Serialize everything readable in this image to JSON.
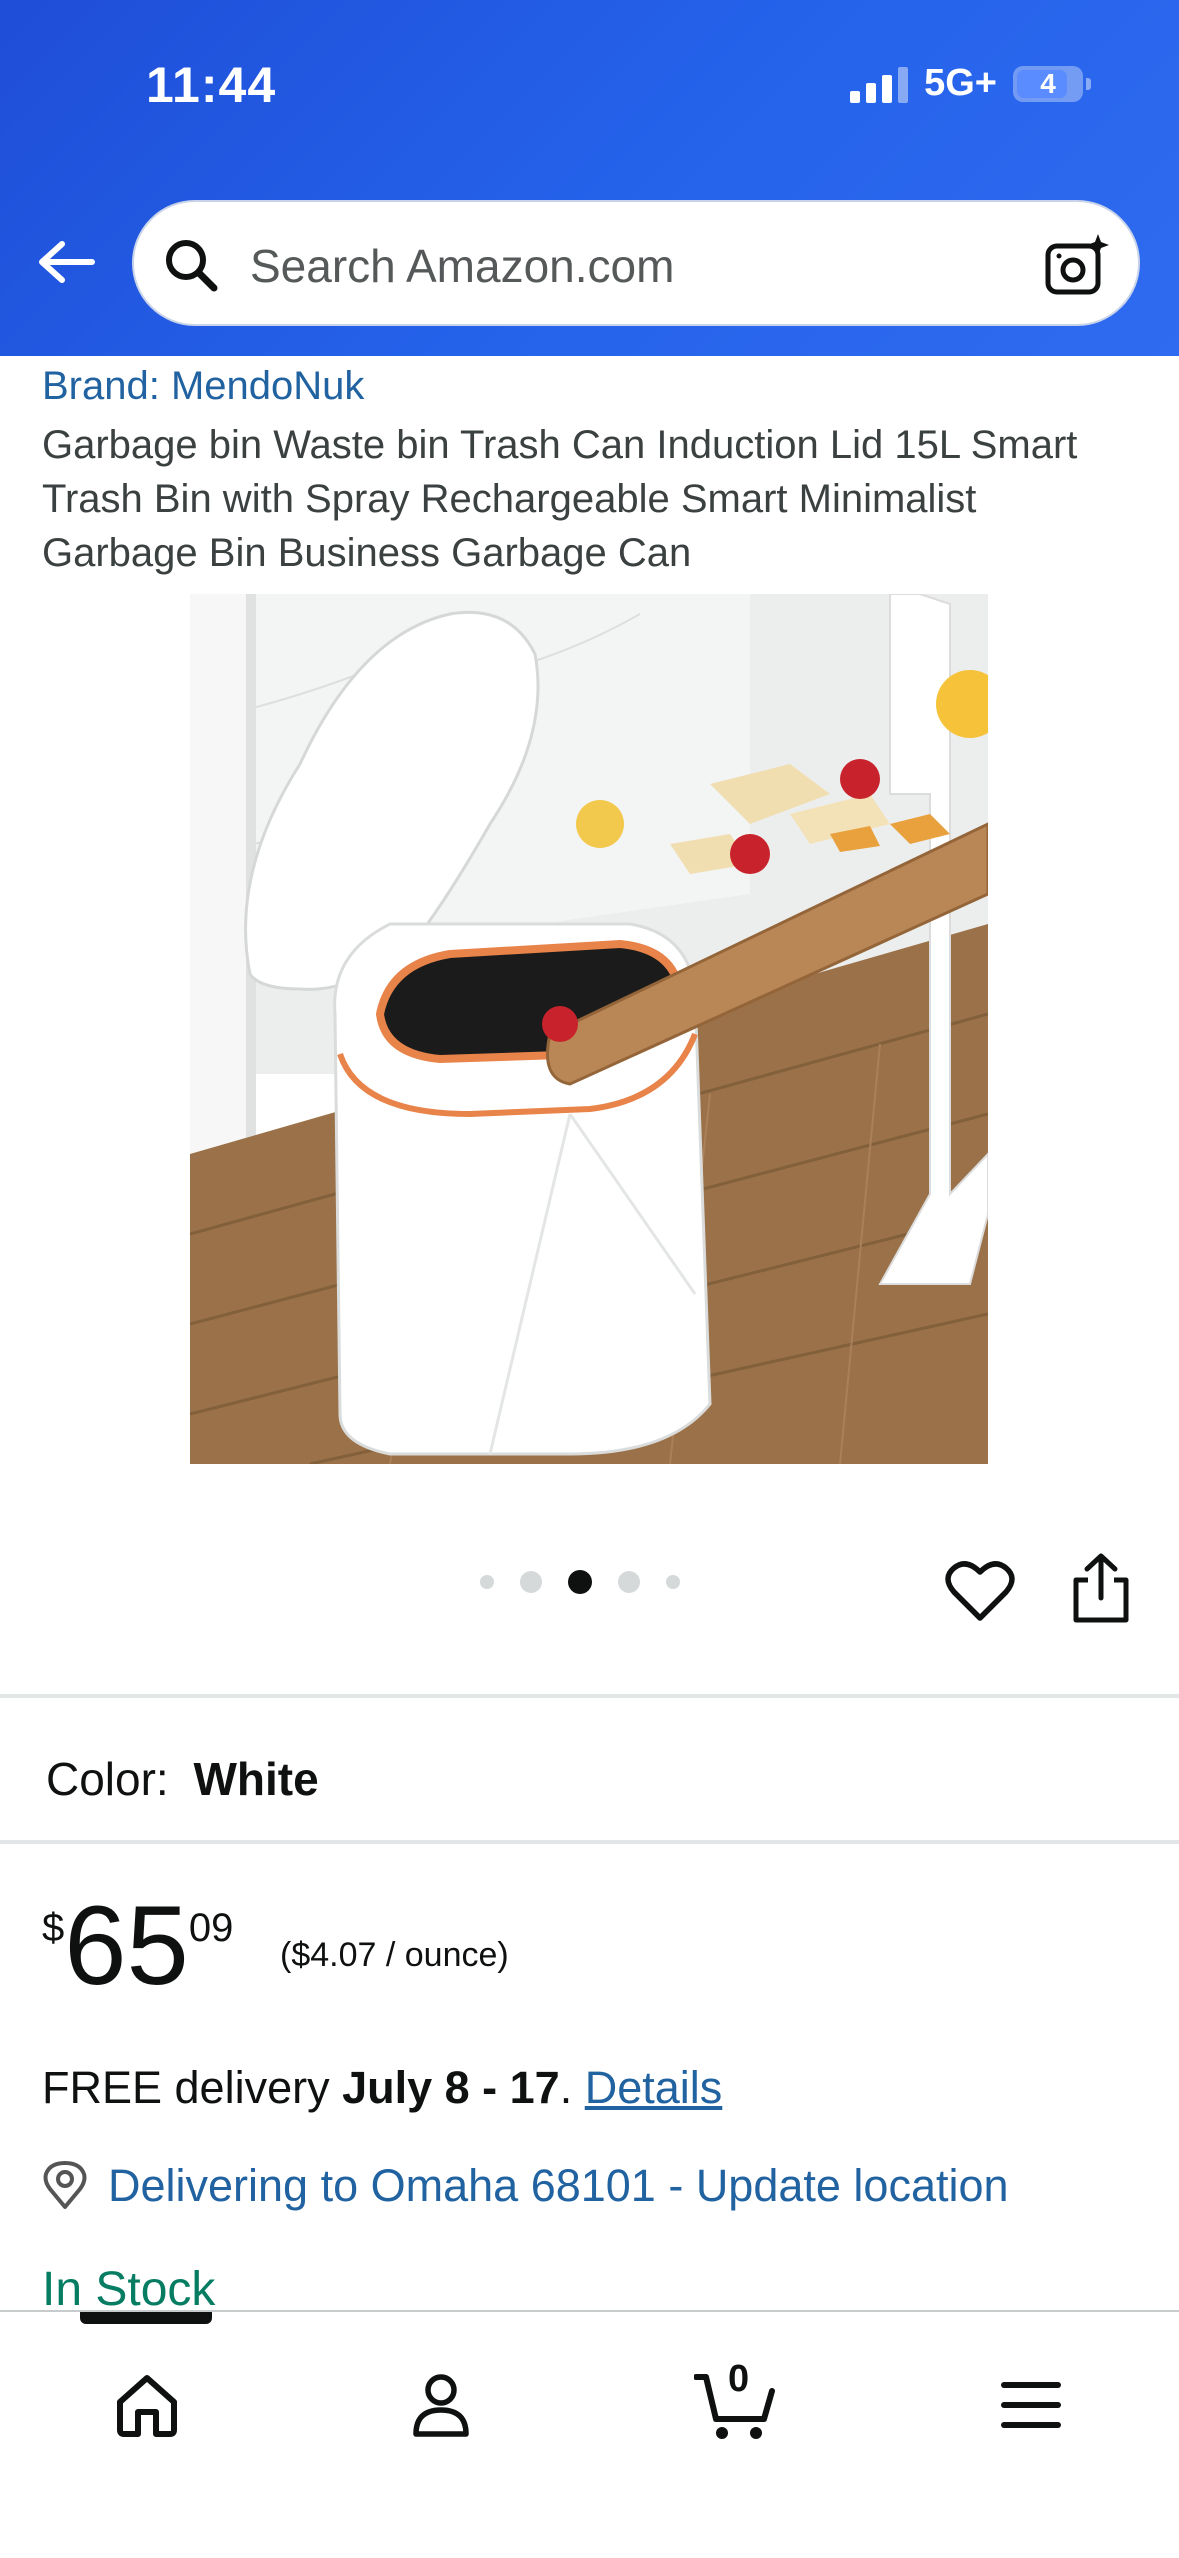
{
  "status_bar": {
    "time": "11:44",
    "network": "5G+",
    "battery": "4"
  },
  "search": {
    "placeholder": "Search Amazon.com",
    "icons": {
      "back": "back-arrow-icon",
      "search": "search-icon",
      "camera": "camera-lens-icon"
    }
  },
  "product": {
    "brand": "Brand: MendoNuk",
    "title": "Garbage bin Waste bin Trash Can Induction Lid 15L Smart Trash Bin with Spray Rechargeable Smart Minimalist Garbage Bin Business Garbage Can",
    "image_dots_total": 5,
    "image_dot_active": 3,
    "color_label": "Color:",
    "color_value": "White",
    "price_symbol": "$",
    "price_whole": "65",
    "price_fraction": "09",
    "unit_price": "($4.07 / ounce)",
    "delivery_prefix": "FREE delivery ",
    "delivery_dates": "July 8 - 17",
    "delivery_suffix": ". ",
    "delivery_details_link": "Details",
    "location": "Delivering to Omaha 68101 - Update location",
    "stock": "In Stock"
  },
  "tab_bar": {
    "cart_count": "0",
    "icons": [
      "home-icon",
      "account-icon",
      "cart-icon",
      "menu-icon"
    ]
  },
  "colors": {
    "header_blue": "#2563eb",
    "link_blue": "#2162a1",
    "in_stock_green": "#067d62",
    "text": "#0f1111"
  }
}
